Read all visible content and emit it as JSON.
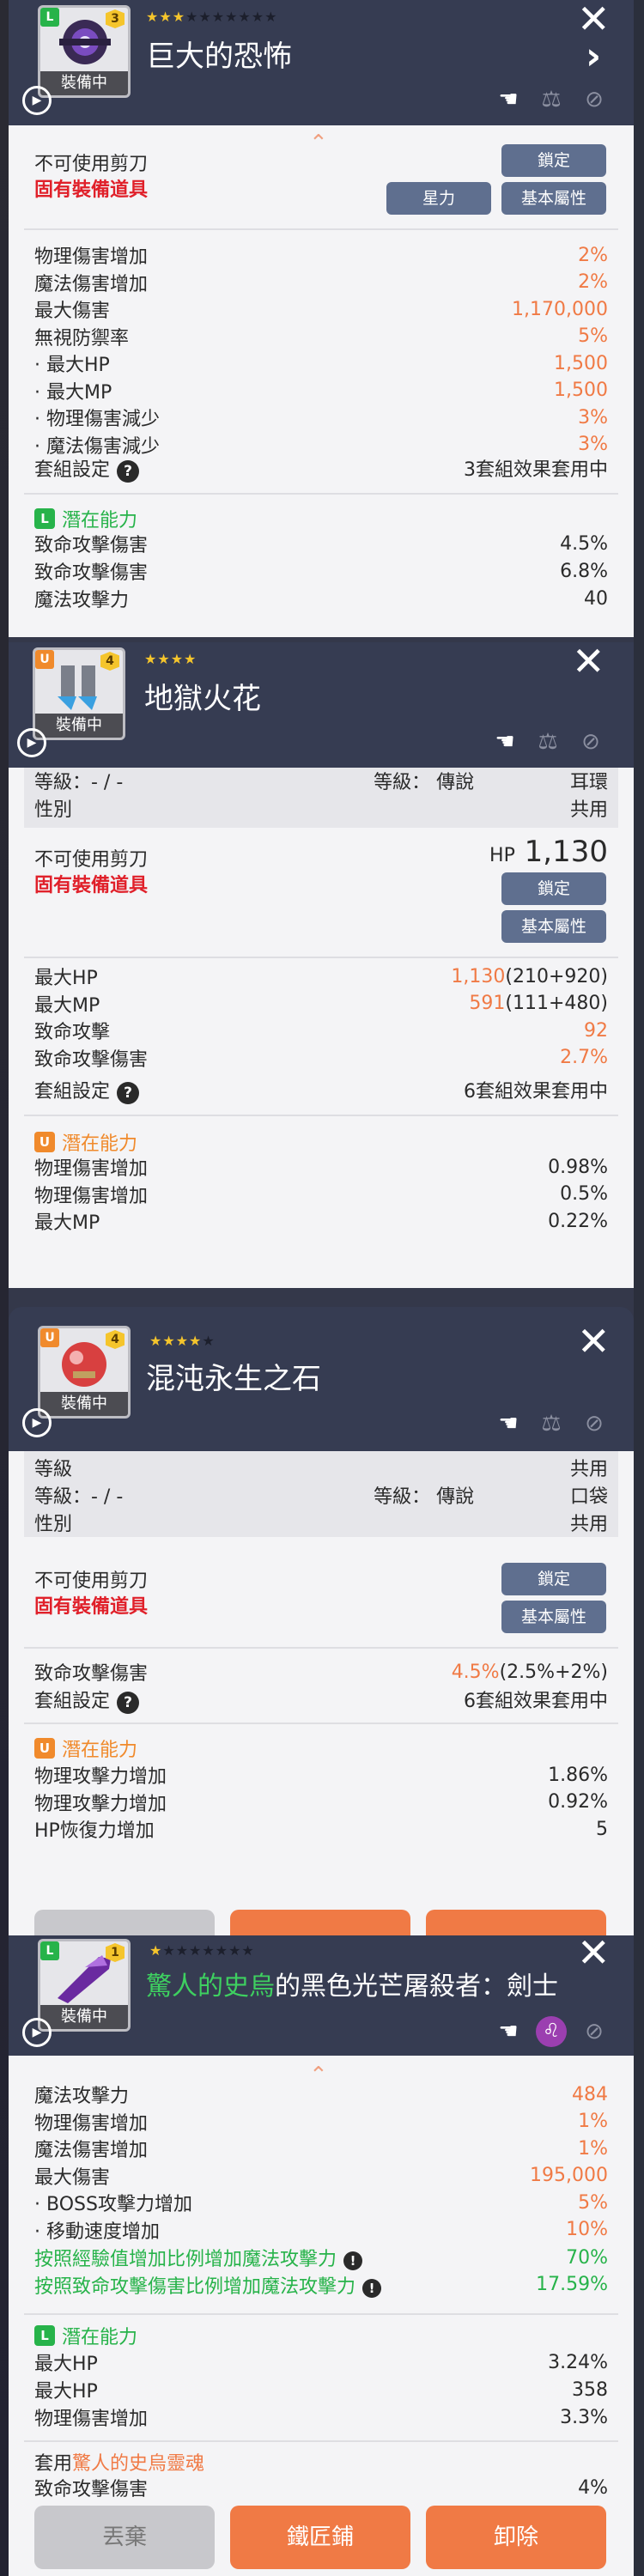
{
  "card1": {
    "stars_on": "★★★",
    "stars_off": "★★★★★★★",
    "level": "3",
    "tier": "L",
    "equipped": "裝備中",
    "title": "巨大的恐怖",
    "note": "不可使用剪刀",
    "unique": "固有裝備道具",
    "btn_lock": "鎖定",
    "btn_star": "星力",
    "btn_base": "基本屬性",
    "stats": [
      [
        "物理傷害增加",
        "2%"
      ],
      [
        "魔法傷害增加",
        "2%"
      ],
      [
        "最大傷害",
        "1,170,000"
      ],
      [
        "無視防禦率",
        "5%"
      ],
      [
        "· 最大HP",
        "1,500"
      ],
      [
        "· 最大MP",
        "1,500"
      ],
      [
        "· 物理傷害減少",
        "3%"
      ],
      [
        "· 魔法傷害減少",
        "3%"
      ]
    ],
    "set_label": "套組設定",
    "set_value": "3套組效果套用中",
    "potential_title": "潛在能力",
    "potentials": [
      [
        "致命攻擊傷害",
        "4.5%"
      ],
      [
        "致命攻擊傷害",
        "6.8%"
      ],
      [
        "魔法攻擊力",
        "40"
      ]
    ]
  },
  "card2": {
    "stars_on": "★★★★",
    "stars_off": "",
    "level": "4",
    "tier": "U",
    "equipped": "裝備中",
    "title": "地獄火花",
    "info_level": "等級：- / -",
    "info_grade": "等級： 傳說",
    "info_slot": "耳環",
    "info_gender": "性別",
    "info_gender_value": "共用",
    "note": "不可使用剪刀",
    "unique": "固有裝備道具",
    "hp_label": "HP",
    "hp_value": "1,130",
    "btn_lock": "鎖定",
    "btn_base": "基本屬性",
    "stats": [
      [
        "最大HP",
        "1,130",
        "(210+920)"
      ],
      [
        "最大MP",
        "591",
        "(111+480)"
      ],
      [
        "致命攻擊",
        "92",
        ""
      ],
      [
        "致命攻擊傷害",
        "2.7%",
        ""
      ]
    ],
    "set_label": "套組設定",
    "set_value": "6套組效果套用中",
    "potential_title": "潛在能力",
    "potentials": [
      [
        "物理傷害增加",
        "0.98%"
      ],
      [
        "物理傷害增加",
        "0.5%"
      ],
      [
        "最大MP",
        "0.22%"
      ]
    ]
  },
  "card3": {
    "stars_on": "★★★★",
    "stars_off": "★",
    "level": "4",
    "tier": "U",
    "equipped": "裝備中",
    "title": "混沌永生之石",
    "info_level_label": "等級",
    "info_level_value": "共用",
    "info_level": "等級：- / -",
    "info_grade": "等級： 傳說",
    "info_slot": "口袋",
    "info_gender": "性別",
    "info_gender_value": "共用",
    "note": "不可使用剪刀",
    "unique": "固有裝備道具",
    "btn_lock": "鎖定",
    "btn_base": "基本屬性",
    "stats": [
      [
        "致命攻擊傷害",
        "4.5%",
        "(2.5%+2%)"
      ]
    ],
    "set_label": "套組設定",
    "set_value": "6套組效果套用中",
    "potential_title": "潛在能力",
    "potentials": [
      [
        "物理攻擊力增加",
        "1.86%"
      ],
      [
        "物理攻擊力增加",
        "0.92%"
      ],
      [
        "HP恢復力增加",
        "5"
      ]
    ]
  },
  "card4": {
    "stars_on": "★",
    "stars_off": "★★★★★★★",
    "level": "1",
    "tier": "L",
    "equipped": "裝備中",
    "title_green": "驚人的史烏",
    "title_rest": "的黑色光芒屠殺者：劍士",
    "stats": [
      [
        "魔法攻擊力",
        "484"
      ],
      [
        "物理傷害增加",
        "1%"
      ],
      [
        "魔法傷害增加",
        "1%"
      ],
      [
        "最大傷害",
        "195,000"
      ],
      [
        "· BOSS攻擊力增加",
        "5%"
      ],
      [
        "· 移動速度增加",
        "10%"
      ]
    ],
    "green_stats": [
      [
        "按照經驗值增加比例增加魔法攻擊力",
        "70%"
      ],
      [
        "按照致命攻擊傷害比例增加魔法攻擊力",
        "17.59%"
      ]
    ],
    "potential_title": "潛在能力",
    "potentials": [
      [
        "最大HP",
        "3.24%"
      ],
      [
        "最大HP",
        "358"
      ],
      [
        "物理傷害增加",
        "3.3%"
      ]
    ],
    "soul_prefix": "套用",
    "soul_name": "驚人的史烏靈魂",
    "soul_stat": [
      "致命攻擊傷害",
      "4%"
    ],
    "btn_discard": "丟棄",
    "btn_smith": "鐵匠鋪",
    "btn_unequip": "卸除"
  },
  "colors": {
    "header": "#363c52",
    "accent_orange": "#f07a45",
    "legendary_green": "#27b34a",
    "unique_orange": "#f08a2c",
    "unique_red": "#e0202a"
  }
}
